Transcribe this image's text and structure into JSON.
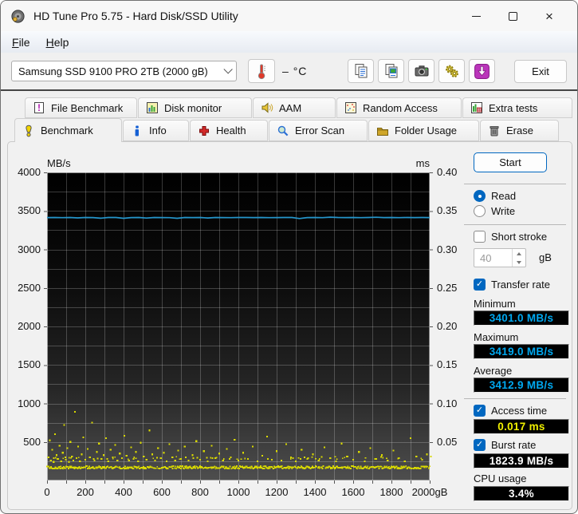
{
  "window": {
    "title": "HD Tune Pro 5.75 - Hard Disk/SSD Utility"
  },
  "menu": {
    "items": [
      "File",
      "Help"
    ]
  },
  "toolbar": {
    "drive_select": {
      "value": "Samsung SSD 9100 PRO 2TB (2000 gB)"
    },
    "temperature": {
      "value": "–",
      "unit": "°C"
    },
    "exit_label": "Exit"
  },
  "tabs": {
    "row1": [
      {
        "label": "File Benchmark"
      },
      {
        "label": "Disk monitor"
      },
      {
        "label": "AAM"
      },
      {
        "label": "Random Access"
      },
      {
        "label": "Extra tests"
      }
    ],
    "row2": [
      {
        "label": "Benchmark",
        "active": true
      },
      {
        "label": "Info"
      },
      {
        "label": "Health"
      },
      {
        "label": "Error Scan"
      },
      {
        "label": "Folder Usage"
      },
      {
        "label": "Erase"
      }
    ]
  },
  "benchmark_panel": {
    "start_button": "Start",
    "mode": {
      "read_label": "Read",
      "write_label": "Write",
      "selected": "Read"
    },
    "short_stroke": {
      "label": "Short stroke",
      "checked": false,
      "size_value": "40",
      "size_unit": "gB"
    },
    "transfer_rate": {
      "label": "Transfer rate",
      "checked": true,
      "minimum_label": "Minimum",
      "minimum": "3401.0 MB/s",
      "maximum_label": "Maximum",
      "maximum": "3419.0 MB/s",
      "average_label": "Average",
      "average": "3412.9 MB/s"
    },
    "access_time": {
      "label": "Access time",
      "checked": true,
      "value": "0.017 ms"
    },
    "burst_rate": {
      "label": "Burst rate",
      "checked": true,
      "value": "1823.9 MB/s"
    },
    "cpu_usage": {
      "label": "CPU usage",
      "value": "3.4%"
    }
  },
  "colors": {
    "accent": "#0067c0",
    "transfer_value": "#00a8f0",
    "access_value": "#f0f000",
    "chart_line": "#2596cc",
    "access_dots": "#d9d900"
  },
  "chart_data": {
    "type": "line",
    "title": "HD Tune Pro read benchmark",
    "x_axis": {
      "unit": "gB",
      "min": 0,
      "max": 2000,
      "grid_step": 100,
      "ticks": [
        0,
        200,
        400,
        600,
        800,
        1000,
        1200,
        1400,
        1600,
        1800,
        2000
      ]
    },
    "y_left": {
      "unit": "MB/s",
      "min": 0,
      "max": 4000,
      "grid_step": 250,
      "ticks": [
        4000,
        3500,
        3000,
        2500,
        2000,
        1500,
        1000,
        500
      ]
    },
    "y_right": {
      "unit": "ms",
      "min": 0,
      "max": 0.4,
      "ticks": [
        0.4,
        0.35,
        0.3,
        0.25,
        0.2,
        0.15,
        0.1,
        0.05
      ]
    },
    "series": [
      {
        "name": "Transfer rate",
        "axis": "left",
        "kind": "line",
        "color": "#2596cc",
        "min": 3401.0,
        "max": 3419.0,
        "avg": 3412.9,
        "points": [
          [
            0,
            3413
          ],
          [
            40,
            3414
          ],
          [
            80,
            3412
          ],
          [
            120,
            3415
          ],
          [
            160,
            3409
          ],
          [
            200,
            3414
          ],
          [
            240,
            3413
          ],
          [
            280,
            3405
          ],
          [
            320,
            3414
          ],
          [
            360,
            3415
          ],
          [
            400,
            3404
          ],
          [
            440,
            3413
          ],
          [
            480,
            3414
          ],
          [
            520,
            3407
          ],
          [
            560,
            3415
          ],
          [
            600,
            3413
          ],
          [
            640,
            3412
          ],
          [
            680,
            3404
          ],
          [
            720,
            3414
          ],
          [
            760,
            3413
          ],
          [
            800,
            3415
          ],
          [
            840,
            3408
          ],
          [
            880,
            3414
          ],
          [
            920,
            3413
          ],
          [
            960,
            3412
          ],
          [
            1000,
            3414
          ],
          [
            1040,
            3415
          ],
          [
            1080,
            3413
          ],
          [
            1120,
            3414
          ],
          [
            1160,
            3412
          ],
          [
            1200,
            3413
          ],
          [
            1240,
            3415
          ],
          [
            1280,
            3414
          ],
          [
            1320,
            3401
          ],
          [
            1360,
            3413
          ],
          [
            1400,
            3414
          ],
          [
            1440,
            3412
          ],
          [
            1480,
            3419
          ],
          [
            1520,
            3414
          ],
          [
            1560,
            3413
          ],
          [
            1600,
            3415
          ],
          [
            1640,
            3412
          ],
          [
            1680,
            3414
          ],
          [
            1720,
            3418
          ],
          [
            1760,
            3413
          ],
          [
            1800,
            3414
          ],
          [
            1840,
            3412
          ],
          [
            1880,
            3415
          ],
          [
            1920,
            3413
          ],
          [
            1960,
            3414
          ],
          [
            2000,
            3413
          ]
        ]
      },
      {
        "name": "Access time",
        "axis": "right",
        "kind": "scatter",
        "color": "#d9d900",
        "baseline_ms": 0.017,
        "average_ms": 0.017,
        "points": [
          [
            8,
            0.03
          ],
          [
            14,
            0.052
          ],
          [
            20,
            0.026
          ],
          [
            27,
            0.04
          ],
          [
            34,
            0.024
          ],
          [
            42,
            0.06
          ],
          [
            50,
            0.033
          ],
          [
            58,
            0.028
          ],
          [
            66,
            0.045
          ],
          [
            74,
            0.025
          ],
          [
            82,
            0.036
          ],
          [
            90,
            0.072
          ],
          [
            98,
            0.027
          ],
          [
            106,
            0.042
          ],
          [
            114,
            0.024
          ],
          [
            122,
            0.05
          ],
          [
            130,
            0.031
          ],
          [
            138,
            0.026
          ],
          [
            146,
            0.089
          ],
          [
            154,
            0.029
          ],
          [
            163,
            0.044
          ],
          [
            172,
            0.025
          ],
          [
            181,
            0.034
          ],
          [
            190,
            0.056
          ],
          [
            200,
            0.027
          ],
          [
            212,
            0.041
          ],
          [
            224,
            0.03
          ],
          [
            236,
            0.075
          ],
          [
            248,
            0.026
          ],
          [
            260,
            0.037
          ],
          [
            272,
            0.048
          ],
          [
            284,
            0.028
          ],
          [
            296,
            0.033
          ],
          [
            308,
            0.055
          ],
          [
            320,
            0.025
          ],
          [
            332,
            0.04
          ],
          [
            344,
            0.03
          ],
          [
            356,
            0.046
          ],
          [
            368,
            0.026
          ],
          [
            380,
            0.035
          ],
          [
            392,
            0.029
          ],
          [
            404,
            0.058
          ],
          [
            416,
            0.032
          ],
          [
            428,
            0.026
          ],
          [
            440,
            0.043
          ],
          [
            452,
            0.028
          ],
          [
            464,
            0.037
          ],
          [
            476,
            0.025
          ],
          [
            490,
            0.049
          ],
          [
            505,
            0.031
          ],
          [
            520,
            0.027
          ],
          [
            535,
            0.065
          ],
          [
            550,
            0.034
          ],
          [
            565,
            0.026
          ],
          [
            580,
            0.042
          ],
          [
            595,
            0.029
          ],
          [
            610,
            0.036
          ],
          [
            625,
            0.025
          ],
          [
            640,
            0.047
          ],
          [
            655,
            0.03
          ],
          [
            670,
            0.026
          ],
          [
            685,
            0.039
          ],
          [
            700,
            0.028
          ],
          [
            720,
            0.044
          ],
          [
            740,
            0.026
          ],
          [
            760,
            0.033
          ],
          [
            780,
            0.051
          ],
          [
            800,
            0.027
          ],
          [
            820,
            0.038
          ],
          [
            840,
            0.025
          ],
          [
            860,
            0.045
          ],
          [
            880,
            0.029
          ],
          [
            900,
            0.035
          ],
          [
            920,
            0.026
          ],
          [
            940,
            0.041
          ],
          [
            960,
            0.03
          ],
          [
            980,
            0.053
          ],
          [
            1000,
            0.026
          ],
          [
            1025,
            0.036
          ],
          [
            1050,
            0.028
          ],
          [
            1075,
            0.044
          ],
          [
            1100,
            0.025
          ],
          [
            1125,
            0.032
          ],
          [
            1150,
            0.057
          ],
          [
            1175,
            0.027
          ],
          [
            1200,
            0.038
          ],
          [
            1225,
            0.026
          ],
          [
            1250,
            0.047
          ],
          [
            1275,
            0.03
          ],
          [
            1300,
            0.025
          ],
          [
            1330,
            0.04
          ],
          [
            1360,
            0.028
          ],
          [
            1390,
            0.034
          ],
          [
            1420,
            0.026
          ],
          [
            1450,
            0.043
          ],
          [
            1480,
            0.029
          ],
          [
            1510,
            0.025
          ],
          [
            1540,
            0.048
          ],
          [
            1570,
            0.031
          ],
          [
            1600,
            0.027
          ],
          [
            1630,
            0.037
          ],
          [
            1660,
            0.025
          ],
          [
            1690,
            0.042
          ],
          [
            1720,
            0.028
          ],
          [
            1750,
            0.033
          ],
          [
            1780,
            0.026
          ],
          [
            1810,
            0.039
          ],
          [
            1840,
            0.029
          ],
          [
            1870,
            0.025
          ],
          [
            1900,
            0.055
          ],
          [
            1930,
            0.031
          ],
          [
            1960,
            0.027
          ],
          [
            1985,
            0.034
          ]
        ]
      }
    ]
  }
}
